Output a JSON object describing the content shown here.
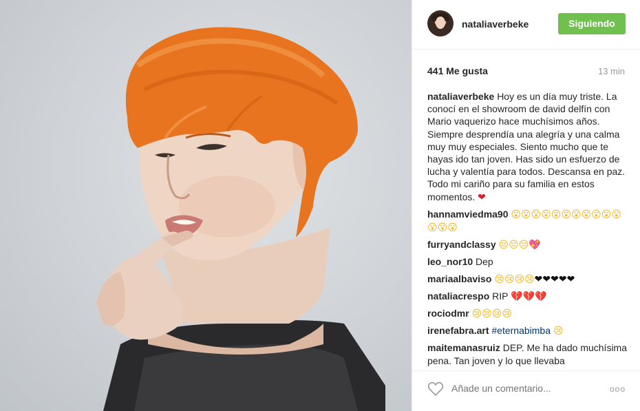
{
  "post": {
    "username": "nataliaverbeke",
    "follow_label": "Siguiendo",
    "likes": "441 Me gusta",
    "time": "13 min"
  },
  "comments": [
    {
      "user": "nataliaverbeke",
      "text": "Hoy es un día muy triste. La conocí en el showroom de david delfín con Mario vaquerizo hace muchísimos años. Siempre desprendía una alegría y una calma muy muy especiales. Siento mucho que te hayas ido tan joven. Has sido un esfuerzo de lucha y valentía para todos. Descansa en paz. Todo mi cariño para su familia en estos momentos. ",
      "emoji": "❤"
    },
    {
      "user": "hannamviedma90",
      "text": "",
      "emoji": "😮😮😮😮😮😮😮😮😮😮😮😮😮😮"
    },
    {
      "user": "furryandclassy",
      "text": "",
      "emoji": "😔😔😔💖"
    },
    {
      "user": "leo_nor10",
      "text": "Dep",
      "emoji": ""
    },
    {
      "user": "mariaalbaviso",
      "text": "",
      "emoji": "😢😢😢😢",
      "emoji2": "❤❤❤❤❤"
    },
    {
      "user": "nataliacrespo",
      "text": "RIP ",
      "emoji": "💔💔💔"
    },
    {
      "user": "rociodmr",
      "text": "",
      "emoji": "😢😢😢😢"
    },
    {
      "user": "irenefabra.art",
      "tag": "#eternabimba",
      "emoji": "😢"
    },
    {
      "user": "maitemanasruiz",
      "text": "DEP. Me ha dado muchísima pena. Tan joven y lo que llevaba",
      "emoji": ""
    }
  ],
  "composer": {
    "placeholder": "Añade un comentario...",
    "more": "ooo"
  },
  "icons": {
    "like": "heart-outline-icon",
    "more": "more-options-icon"
  },
  "colors": {
    "follow_button": "#70c050",
    "hair": "#e8741f",
    "hashtag": "#003569"
  }
}
